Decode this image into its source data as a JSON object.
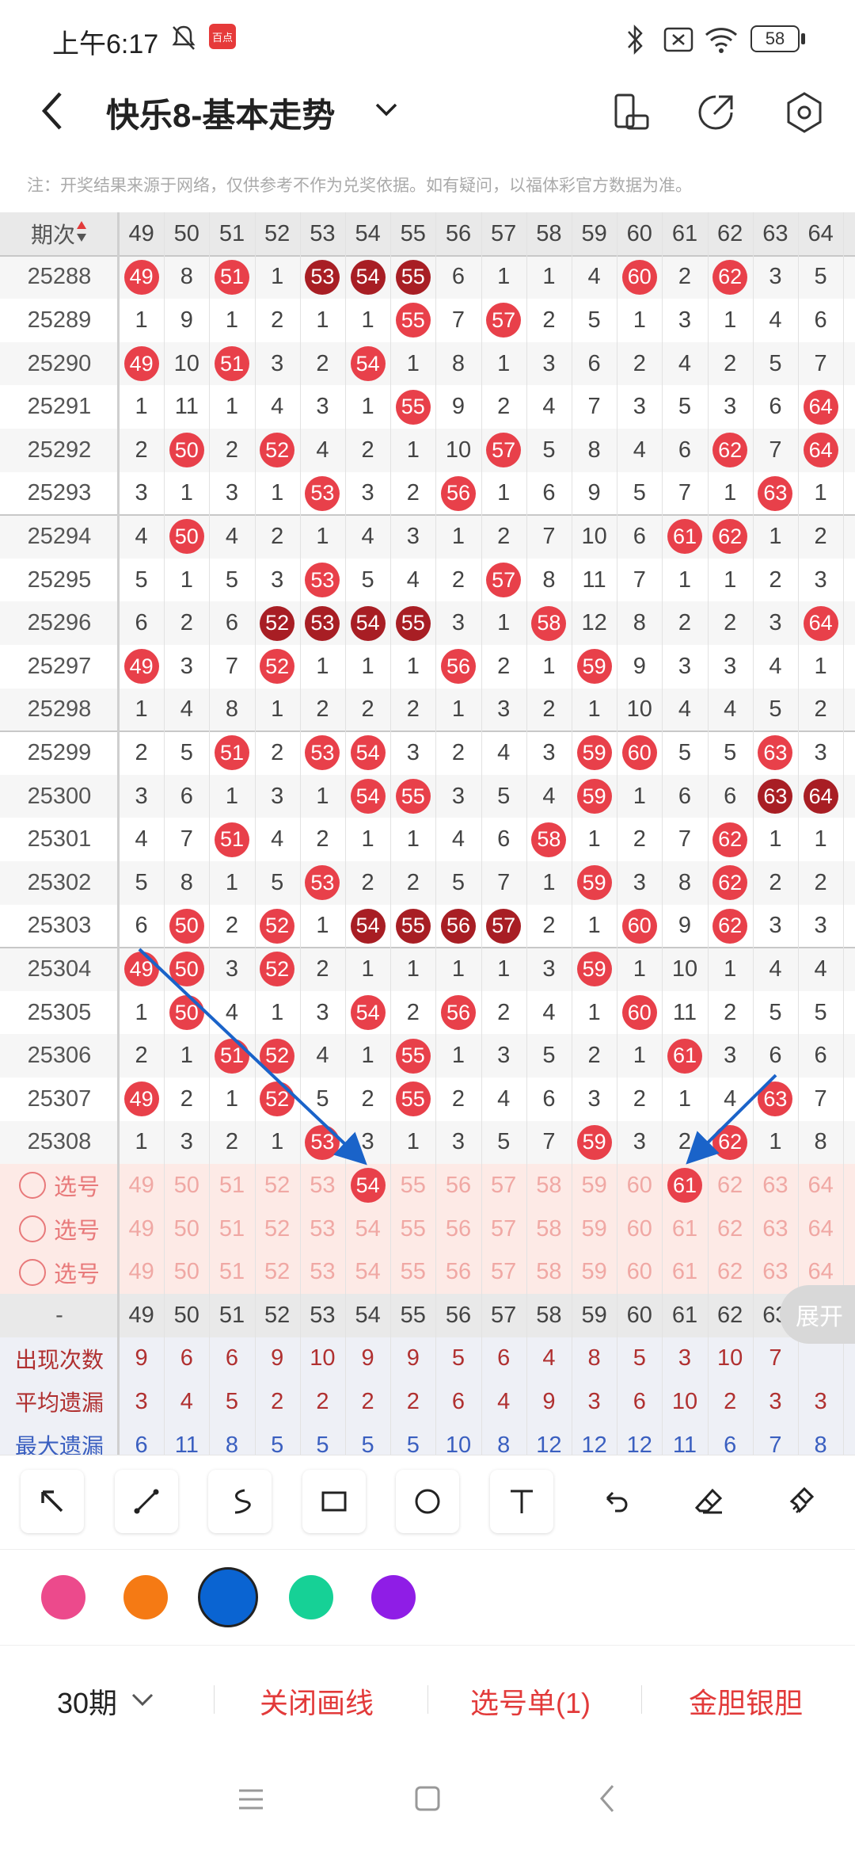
{
  "status": {
    "time": "上午6:17",
    "battery": "58",
    "app_badge": "百点"
  },
  "header": {
    "title": "快乐8-基本走势"
  },
  "notice": "注：开奖结果来源于网络，仅供参考不作为兑奖依据。如有疑问，以福体彩官方数据为准。",
  "table": {
    "period_header": "期次",
    "columns": [
      "49",
      "50",
      "51",
      "52",
      "53",
      "54",
      "55",
      "56",
      "57",
      "58",
      "59",
      "60",
      "61",
      "62",
      "63",
      "64"
    ],
    "rows": [
      {
        "period": "25288",
        "cells": [
          "49",
          "8",
          "51",
          "1",
          "53",
          "54",
          "55",
          "6",
          "1",
          "1",
          "4",
          "60",
          "2",
          "62",
          "3",
          "5"
        ],
        "hits": [
          "r",
          "",
          "r",
          "",
          "d",
          "d",
          "d",
          "",
          "",
          "",
          "",
          "r",
          "",
          "r",
          "",
          ""
        ]
      },
      {
        "period": "25289",
        "cells": [
          "1",
          "9",
          "1",
          "2",
          "1",
          "1",
          "55",
          "7",
          "57",
          "2",
          "5",
          "1",
          "3",
          "1",
          "4",
          "6"
        ],
        "hits": [
          "",
          "",
          "",
          "",
          "",
          "",
          "r",
          "",
          "r",
          "",
          "",
          "",
          "",
          "",
          "",
          ""
        ]
      },
      {
        "period": "25290",
        "cells": [
          "49",
          "10",
          "51",
          "3",
          "2",
          "54",
          "1",
          "8",
          "1",
          "3",
          "6",
          "2",
          "4",
          "2",
          "5",
          "7"
        ],
        "hits": [
          "r",
          "",
          "r",
          "",
          "",
          "r",
          "",
          "",
          "",
          "",
          "",
          "",
          "",
          "",
          "",
          ""
        ]
      },
      {
        "period": "25291",
        "cells": [
          "1",
          "11",
          "1",
          "4",
          "3",
          "1",
          "55",
          "9",
          "2",
          "4",
          "7",
          "3",
          "5",
          "3",
          "6",
          "64"
        ],
        "hits": [
          "",
          "",
          "",
          "",
          "",
          "",
          "r",
          "",
          "",
          "",
          "",
          "",
          "",
          "",
          "",
          "r"
        ]
      },
      {
        "period": "25292",
        "cells": [
          "2",
          "50",
          "2",
          "52",
          "4",
          "2",
          "1",
          "10",
          "57",
          "5",
          "8",
          "4",
          "6",
          "62",
          "7",
          "64"
        ],
        "hits": [
          "",
          "r",
          "",
          "r",
          "",
          "",
          "",
          "",
          "r",
          "",
          "",
          "",
          "",
          "r",
          "",
          "r"
        ]
      },
      {
        "period": "25293",
        "cells": [
          "3",
          "1",
          "3",
          "1",
          "53",
          "3",
          "2",
          "56",
          "1",
          "6",
          "9",
          "5",
          "7",
          "1",
          "63",
          "1"
        ],
        "hits": [
          "",
          "",
          "",
          "",
          "r",
          "",
          "",
          "r",
          "",
          "",
          "",
          "",
          "",
          "",
          "r",
          ""
        ]
      },
      {
        "period": "25294",
        "cells": [
          "4",
          "50",
          "4",
          "2",
          "1",
          "4",
          "3",
          "1",
          "2",
          "7",
          "10",
          "6",
          "61",
          "62",
          "1",
          "2"
        ],
        "hits": [
          "",
          "r",
          "",
          "",
          "",
          "",
          "",
          "",
          "",
          "",
          "",
          "",
          "r",
          "r",
          "",
          ""
        ]
      },
      {
        "period": "25295",
        "cells": [
          "5",
          "1",
          "5",
          "3",
          "53",
          "5",
          "4",
          "2",
          "57",
          "8",
          "11",
          "7",
          "1",
          "1",
          "2",
          "3"
        ],
        "hits": [
          "",
          "",
          "",
          "",
          "r",
          "",
          "",
          "",
          "r",
          "",
          "",
          "",
          "",
          "",
          "",
          ""
        ]
      },
      {
        "period": "25296",
        "cells": [
          "6",
          "2",
          "6",
          "52",
          "53",
          "54",
          "55",
          "3",
          "1",
          "58",
          "12",
          "8",
          "2",
          "2",
          "3",
          "64"
        ],
        "hits": [
          "",
          "",
          "",
          "d",
          "d",
          "d",
          "d",
          "",
          "",
          "r",
          "",
          "",
          "",
          "",
          "",
          "r"
        ]
      },
      {
        "period": "25297",
        "cells": [
          "49",
          "3",
          "7",
          "52",
          "1",
          "1",
          "1",
          "56",
          "2",
          "1",
          "59",
          "9",
          "3",
          "3",
          "4",
          "1"
        ],
        "hits": [
          "r",
          "",
          "",
          "r",
          "",
          "",
          "",
          "r",
          "",
          "",
          "r",
          "",
          "",
          "",
          "",
          ""
        ]
      },
      {
        "period": "25298",
        "cells": [
          "1",
          "4",
          "8",
          "1",
          "2",
          "2",
          "2",
          "1",
          "3",
          "2",
          "1",
          "10",
          "4",
          "4",
          "5",
          "2"
        ],
        "hits": [
          "",
          "",
          "",
          "",
          "",
          "",
          "",
          "",
          "",
          "",
          "",
          "",
          "",
          "",
          "",
          ""
        ]
      },
      {
        "period": "25299",
        "cells": [
          "2",
          "5",
          "51",
          "2",
          "53",
          "54",
          "3",
          "2",
          "4",
          "3",
          "59",
          "60",
          "5",
          "5",
          "63",
          "3"
        ],
        "hits": [
          "",
          "",
          "r",
          "",
          "r",
          "r",
          "",
          "",
          "",
          "",
          "r",
          "r",
          "",
          "",
          "r",
          ""
        ]
      },
      {
        "period": "25300",
        "cells": [
          "3",
          "6",
          "1",
          "3",
          "1",
          "54",
          "55",
          "3",
          "5",
          "4",
          "59",
          "1",
          "6",
          "6",
          "63",
          "64"
        ],
        "hits": [
          "",
          "",
          "",
          "",
          "",
          "r",
          "r",
          "",
          "",
          "",
          "r",
          "",
          "",
          "",
          "d",
          "d"
        ]
      },
      {
        "period": "25301",
        "cells": [
          "4",
          "7",
          "51",
          "4",
          "2",
          "1",
          "1",
          "4",
          "6",
          "58",
          "1",
          "2",
          "7",
          "62",
          "1",
          "1"
        ],
        "hits": [
          "",
          "",
          "r",
          "",
          "",
          "",
          "",
          "",
          "",
          "r",
          "",
          "",
          "",
          "r",
          "",
          ""
        ]
      },
      {
        "period": "25302",
        "cells": [
          "5",
          "8",
          "1",
          "5",
          "53",
          "2",
          "2",
          "5",
          "7",
          "1",
          "59",
          "3",
          "8",
          "62",
          "2",
          "2"
        ],
        "hits": [
          "",
          "",
          "",
          "",
          "r",
          "",
          "",
          "",
          "",
          "",
          "r",
          "",
          "",
          "r",
          "",
          ""
        ]
      },
      {
        "period": "25303",
        "cells": [
          "6",
          "50",
          "2",
          "52",
          "1",
          "54",
          "55",
          "56",
          "57",
          "2",
          "1",
          "60",
          "9",
          "62",
          "3",
          "3"
        ],
        "hits": [
          "",
          "r",
          "",
          "r",
          "",
          "d",
          "d",
          "d",
          "d",
          "",
          "",
          "r",
          "",
          "r",
          "",
          ""
        ]
      },
      {
        "period": "25304",
        "cells": [
          "49",
          "50",
          "3",
          "52",
          "2",
          "1",
          "1",
          "1",
          "1",
          "3",
          "59",
          "1",
          "10",
          "1",
          "4",
          "4"
        ],
        "hits": [
          "r",
          "r",
          "",
          "r",
          "",
          "",
          "",
          "",
          "",
          "",
          "r",
          "",
          "",
          "",
          "",
          ""
        ]
      },
      {
        "period": "25305",
        "cells": [
          "1",
          "50",
          "4",
          "1",
          "3",
          "54",
          "2",
          "56",
          "2",
          "4",
          "1",
          "60",
          "11",
          "2",
          "5",
          "5"
        ],
        "hits": [
          "",
          "r",
          "",
          "",
          "",
          "r",
          "",
          "r",
          "",
          "",
          "",
          "r",
          "",
          "",
          "",
          ""
        ]
      },
      {
        "period": "25306",
        "cells": [
          "2",
          "1",
          "51",
          "52",
          "4",
          "1",
          "55",
          "1",
          "3",
          "5",
          "2",
          "1",
          "61",
          "3",
          "6",
          "6"
        ],
        "hits": [
          "",
          "",
          "r",
          "r",
          "",
          "",
          "r",
          "",
          "",
          "",
          "",
          "",
          "r",
          "",
          "",
          ""
        ]
      },
      {
        "period": "25307",
        "cells": [
          "49",
          "2",
          "1",
          "52",
          "5",
          "2",
          "55",
          "2",
          "4",
          "6",
          "3",
          "2",
          "1",
          "4",
          "63",
          "7"
        ],
        "hits": [
          "r",
          "",
          "",
          "r",
          "",
          "",
          "r",
          "",
          "",
          "",
          "",
          "",
          "",
          "",
          "r",
          ""
        ]
      },
      {
        "period": "25308",
        "cells": [
          "1",
          "3",
          "2",
          "1",
          "53",
          "3",
          "1",
          "3",
          "5",
          "7",
          "59",
          "3",
          "2",
          "62",
          "1",
          "8"
        ],
        "hits": [
          "",
          "",
          "",
          "",
          "r",
          "",
          "",
          "",
          "",
          "",
          "r",
          "",
          "",
          "r",
          "",
          ""
        ]
      }
    ],
    "select_label": "选号",
    "select_rows": [
      {
        "selected": "54"
      },
      {
        "selected": ""
      },
      {
        "selected": ""
      }
    ],
    "selected_ball_2": "61",
    "stats_header": "-",
    "stats": [
      {
        "label": "出现次数",
        "values": [
          "9",
          "6",
          "6",
          "9",
          "10",
          "9",
          "9",
          "5",
          "6",
          "4",
          "8",
          "5",
          "3",
          "10",
          "7",
          ""
        ],
        "color": "#b03030"
      },
      {
        "label": "平均遗漏",
        "values": [
          "3",
          "4",
          "5",
          "2",
          "2",
          "2",
          "2",
          "6",
          "4",
          "9",
          "3",
          "6",
          "10",
          "2",
          "3",
          "3"
        ],
        "color": "#b03030"
      },
      {
        "label": "最大遗漏",
        "values": [
          "6",
          "11",
          "8",
          "5",
          "5",
          "5",
          "5",
          "10",
          "8",
          "12",
          "12",
          "12",
          "11",
          "6",
          "7",
          "8"
        ],
        "color": "#3a5fc0"
      }
    ],
    "expand_label": "展开"
  },
  "colors": {
    "pink": "#ec4a8c",
    "orange": "#f57a14",
    "blue": "#0a64d2",
    "green": "#16d196",
    "purple": "#8f1de6",
    "arrow": "#1a63c9",
    "red": "#e8404a",
    "dark": "#a81e24"
  },
  "tools": [
    "arrow-tool-icon",
    "line-tool-icon",
    "curve-tool-icon",
    "rect-tool-icon",
    "circle-tool-icon",
    "text-tool-icon",
    "undo-icon",
    "eraser-icon",
    "clear-icon"
  ],
  "bottombar": {
    "period": "30期",
    "close_lines": "关闭画线",
    "ticket": "选号单(1)",
    "gold": "金胆银胆"
  }
}
